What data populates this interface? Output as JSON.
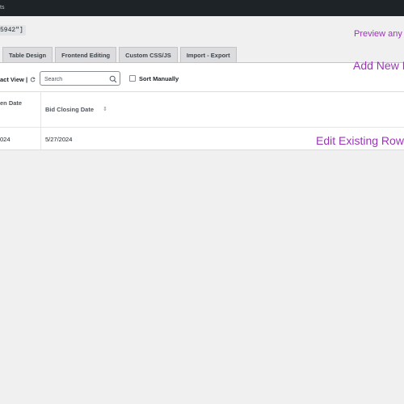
{
  "topbar": {
    "title": "ts"
  },
  "shortcode": {
    "text": "5942\"]"
  },
  "annotations": {
    "preview": "Preview any c",
    "add_new": "Add New R",
    "edit_existing": "Edit Existing Rows"
  },
  "tabs": [
    {
      "label": "Table Design"
    },
    {
      "label": "Frontend Editing"
    },
    {
      "label": "Custom CSS/JS"
    },
    {
      "label": "Import - Export"
    }
  ],
  "toolbar": {
    "compact_view_label": "act View |",
    "search_placeholder": "Search",
    "sort_manually_label": "Sort Manually"
  },
  "table": {
    "headers": [
      "en Date",
      "Bid Closing Date"
    ],
    "rows": [
      [
        "024",
        "5/27/2024"
      ]
    ]
  },
  "icons": {
    "refresh": "refresh-icon",
    "search": "search-icon",
    "sort": "sort-arrows-icon"
  },
  "colors": {
    "annotation": "#9b35b8",
    "topbar": "#1d2327"
  }
}
